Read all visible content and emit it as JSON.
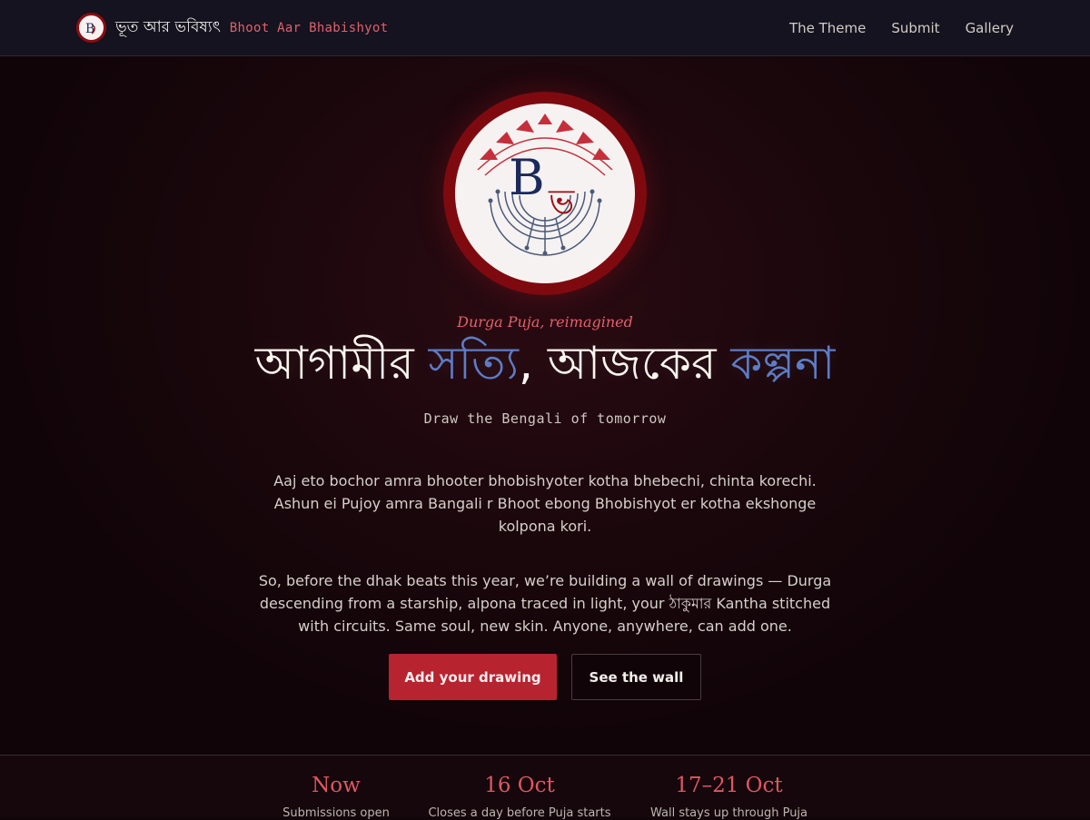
{
  "nav": {
    "brand_bengali": "ভূত আর ভবিষ্যৎ",
    "brand_english": "Bhoot Aar Bhabishyot",
    "links": [
      {
        "label": "The Theme"
      },
      {
        "label": "Submit"
      },
      {
        "label": "Gallery"
      }
    ]
  },
  "emblem": {
    "monogram": "B",
    "accent_glyph": "ভ",
    "nav_monogram": "B"
  },
  "hero": {
    "tagline": "Durga Puja, reimagined",
    "headline": {
      "part1": "আগামীর ",
      "accent1": "সত্যি",
      "part2": ", আজকের ",
      "accent2": "কল্পনা"
    },
    "subhead": "Draw the Bengali of tomorrow",
    "paragraph1": "Aaj eto bochor amra bhooter bhobishyoter kotha bhebechi, chinta korechi. Ashun ei Pujoy amra Bangali r Bhoot ebong Bhobishyot er kotha ekshonge kolpona kori.",
    "paragraph2": "So, before the dhak beats this year, we’re building a wall of drawings — Durga descending from a starship, alpona traced in light, your ঠাকুমার Kantha stitched with circuits. Same soul, new skin. Anyone, anywhere, can add one.",
    "primary_button": "Add your drawing",
    "secondary_button": "See the wall"
  },
  "timeline": [
    {
      "title": "Now",
      "subtitle": "Submissions open"
    },
    {
      "title": "16 Oct",
      "subtitle": "Closes a day before Puja starts"
    },
    {
      "title": "17–21 Oct",
      "subtitle": "Wall stays up through Puja"
    }
  ],
  "colors": {
    "accent_red": "#b82330",
    "accent_blue": "#5d7cc8",
    "rose_text": "#e4606a",
    "background": "#120509"
  }
}
